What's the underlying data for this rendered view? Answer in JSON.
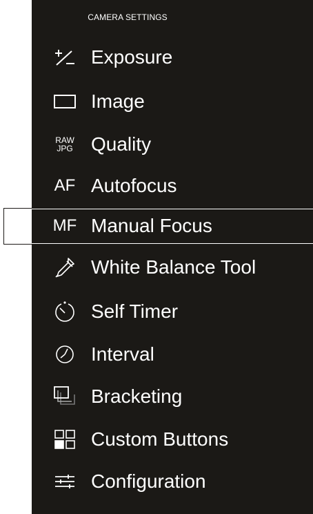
{
  "header": {
    "title": "CAMERA SETTINGS"
  },
  "menu": {
    "items": [
      {
        "label": "Exposure",
        "icon": "exposure-compensation-icon"
      },
      {
        "label": "Image",
        "icon": "image-frame-icon"
      },
      {
        "label": "Quality",
        "icon": "raw-jpg-icon",
        "icon_text_top": "RAW",
        "icon_text_bottom": "JPG"
      },
      {
        "label": "Autofocus",
        "icon": "autofocus-icon",
        "icon_text": "AF"
      },
      {
        "label": "Manual Focus",
        "icon": "manual-focus-icon",
        "icon_text": "MF",
        "selected": true
      },
      {
        "label": "White Balance Tool",
        "icon": "eyedropper-icon"
      },
      {
        "label": "Self Timer",
        "icon": "self-timer-icon"
      },
      {
        "label": "Interval",
        "icon": "interval-clock-icon"
      },
      {
        "label": "Bracketing",
        "icon": "bracketing-icon"
      },
      {
        "label": "Custom Buttons",
        "icon": "custom-buttons-grid-icon"
      },
      {
        "label": "Configuration",
        "icon": "configuration-sliders-icon"
      }
    ]
  },
  "colors": {
    "panel_background": "#1b1916",
    "text": "#ffffff",
    "page_background": "#ffffff"
  }
}
